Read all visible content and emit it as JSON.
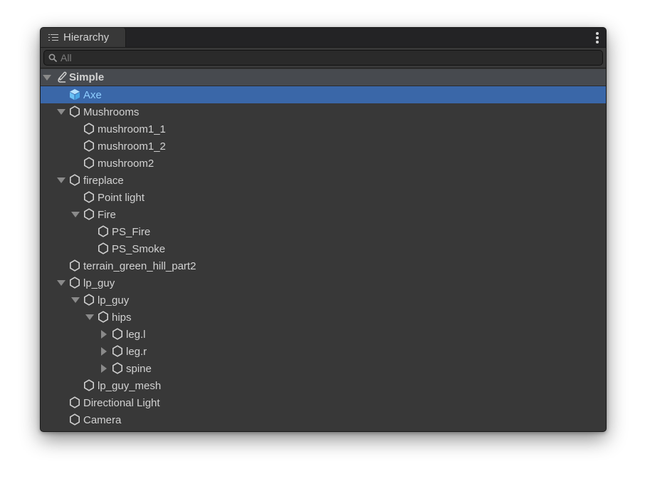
{
  "window": {
    "tab_label": "Hierarchy",
    "tab_icon": "list-icon",
    "menu_icon": "kebab-menu-icon"
  },
  "search": {
    "placeholder": "All",
    "value": "",
    "icon": "search-icon"
  },
  "scene": {
    "name": "Simple",
    "expanded": true,
    "icon": "scene-icon"
  },
  "colors": {
    "panel_bg": "#383838",
    "tabbar_bg": "#232325",
    "scene_row_bg": "#474a4f",
    "selection_bg": "#3a67a8",
    "selection_text": "#8ecdff",
    "text": "#d2d2d2"
  },
  "items": [
    {
      "label": "Axe",
      "depth": 1,
      "expander": "none",
      "icon": "prefab-cube-icon",
      "selected": true
    },
    {
      "label": "Mushrooms",
      "depth": 1,
      "expander": "expanded",
      "icon": "gameobject-icon"
    },
    {
      "label": "mushroom1_1",
      "depth": 2,
      "expander": "none",
      "icon": "gameobject-icon"
    },
    {
      "label": "mushroom1_2",
      "depth": 2,
      "expander": "none",
      "icon": "gameobject-icon"
    },
    {
      "label": "mushroom2",
      "depth": 2,
      "expander": "none",
      "icon": "gameobject-icon"
    },
    {
      "label": "fireplace",
      "depth": 1,
      "expander": "expanded",
      "icon": "gameobject-icon"
    },
    {
      "label": "Point light",
      "depth": 2,
      "expander": "none",
      "icon": "gameobject-icon"
    },
    {
      "label": "Fire",
      "depth": 2,
      "expander": "expanded",
      "icon": "gameobject-icon"
    },
    {
      "label": "PS_Fire",
      "depth": 3,
      "expander": "none",
      "icon": "gameobject-icon"
    },
    {
      "label": "PS_Smoke",
      "depth": 3,
      "expander": "none",
      "icon": "gameobject-icon"
    },
    {
      "label": "terrain_green_hill_part2",
      "depth": 1,
      "expander": "none",
      "icon": "gameobject-icon"
    },
    {
      "label": "lp_guy",
      "depth": 1,
      "expander": "expanded",
      "icon": "gameobject-icon"
    },
    {
      "label": "lp_guy",
      "depth": 2,
      "expander": "expanded",
      "icon": "gameobject-icon"
    },
    {
      "label": "hips",
      "depth": 3,
      "expander": "expanded",
      "icon": "gameobject-icon"
    },
    {
      "label": "leg.l",
      "depth": 4,
      "expander": "collapsed",
      "icon": "gameobject-icon"
    },
    {
      "label": "leg.r",
      "depth": 4,
      "expander": "collapsed",
      "icon": "gameobject-icon"
    },
    {
      "label": "spine",
      "depth": 4,
      "expander": "collapsed",
      "icon": "gameobject-icon"
    },
    {
      "label": "lp_guy_mesh",
      "depth": 2,
      "expander": "none",
      "icon": "gameobject-icon"
    },
    {
      "label": "Directional Light",
      "depth": 1,
      "expander": "none",
      "icon": "gameobject-icon"
    },
    {
      "label": "Camera",
      "depth": 1,
      "expander": "none",
      "icon": "gameobject-icon"
    }
  ]
}
